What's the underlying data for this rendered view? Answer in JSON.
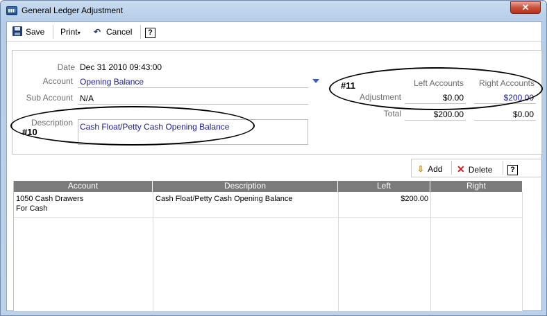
{
  "window": {
    "title": "General Ledger Adjustment",
    "close_glyph": "✕"
  },
  "toolbar": {
    "save_label": "Save",
    "print_label": "Print",
    "cancel_label": "Cancel",
    "help_glyph": "?"
  },
  "form": {
    "date_label": "Date",
    "date_value": "Dec 31 2010 09:43:00",
    "account_label": "Account",
    "account_value": "Opening Balance",
    "sub_account_label": "Sub Account",
    "sub_account_value": "N/A",
    "description_label": "Description",
    "description_value": "Cash Float/Petty Cash Opening Balance"
  },
  "totals": {
    "left_header": "Left Accounts",
    "right_header": "Right Accounts",
    "adjustment_label": "Adjustment",
    "adjustment_left": "$0.00",
    "adjustment_right": "$200.00",
    "total_label": "Total",
    "total_left": "$200.00",
    "total_right": "$0.00"
  },
  "annotations": {
    "desc_marker": "#10",
    "totals_marker": "#11"
  },
  "grid_toolbar": {
    "add_label": "Add",
    "delete_label": "Delete",
    "help_glyph": "?"
  },
  "table": {
    "headers": [
      "Account",
      "Description",
      "Left",
      "Right"
    ],
    "rows": [
      {
        "account_line1": "1050 Cash Drawers",
        "account_line2": "For Cash",
        "description": "Cash Float/Petty Cash Opening Balance",
        "left": "$200.00",
        "right": ""
      }
    ]
  },
  "colors": {
    "accent_blue": "#1a1a8c",
    "header_gray": "#7b7b7b",
    "close_red": "#c9503a"
  }
}
